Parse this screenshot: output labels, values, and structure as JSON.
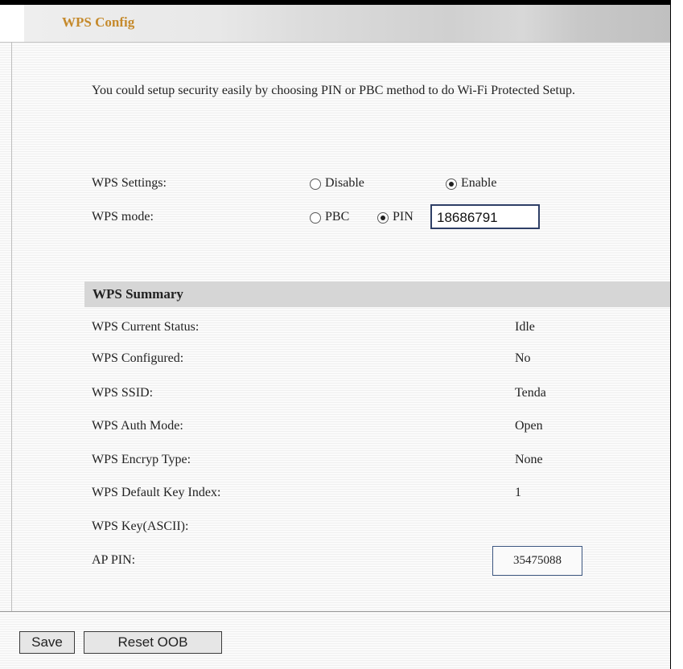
{
  "header": {
    "title": "WPS Config"
  },
  "intro": "You could setup security easily by choosing PIN or PBC method to do Wi-Fi Protected Setup.",
  "wps_settings": {
    "label": "WPS Settings:",
    "options": [
      {
        "label": "Disable",
        "checked": false
      },
      {
        "label": "Enable",
        "checked": true
      }
    ]
  },
  "wps_mode": {
    "label": "WPS mode:",
    "options": [
      {
        "label": "PBC",
        "checked": false
      },
      {
        "label": "PIN",
        "checked": true
      }
    ],
    "pin_value": "18686791"
  },
  "summary": {
    "title": "WPS Summary",
    "rows": [
      {
        "label": "WPS Current Status:",
        "value": "Idle"
      },
      {
        "label": "WPS Configured:",
        "value": "No"
      },
      {
        "label": "WPS SSID:",
        "value": "Tenda"
      },
      {
        "label": "WPS Auth Mode:",
        "value": "Open"
      },
      {
        "label": "WPS Encryp Type:",
        "value": "None"
      },
      {
        "label": "WPS Default Key Index:",
        "value": "1"
      },
      {
        "label": "WPS Key(ASCII):",
        "value": ""
      },
      {
        "label": "AP PIN:",
        "value": "35475088"
      }
    ]
  },
  "buttons": {
    "save": "Save",
    "reset": "Reset OOB"
  },
  "colors": {
    "title": "#c58a2c",
    "summary_bar": "#d6d6d6",
    "input_border": "#2e3f66"
  }
}
